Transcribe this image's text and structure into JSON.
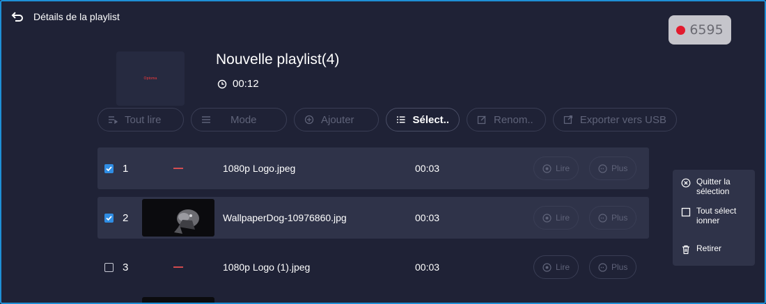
{
  "header": {
    "title": "Détails de la playlist",
    "back_icon": "back-arrow-icon"
  },
  "recording": {
    "count": "6595",
    "dot_color": "#e21b2e"
  },
  "playlist": {
    "logo_text": "Optoma",
    "title": "Nouvelle playlist(4)",
    "duration": "00:12"
  },
  "toolbar": [
    {
      "label": "Tout lire",
      "icon": "play-all-icon",
      "active": false
    },
    {
      "label": "Mode",
      "icon": "mode-icon",
      "active": false
    },
    {
      "label": "Ajouter",
      "icon": "add-icon",
      "active": false
    },
    {
      "label": "Sélect..",
      "icon": "select-list-icon",
      "active": true
    },
    {
      "label": "Renom..",
      "icon": "rename-icon",
      "active": false
    },
    {
      "label": "Exporter vers USB",
      "icon": "export-icon",
      "active": false
    }
  ],
  "rows": [
    {
      "index": "1",
      "checked": true,
      "name": "1080p Logo.jpeg",
      "duration": "00:03",
      "lire": "Lire",
      "plus": "Plus"
    },
    {
      "index": "2",
      "checked": true,
      "name": "WallpaperDog-10976860.jpg",
      "duration": "00:03",
      "lire": "Lire",
      "plus": "Plus"
    },
    {
      "index": "3",
      "checked": false,
      "name": "1080p Logo (1).jpeg",
      "duration": "00:03",
      "lire": "Lire",
      "plus": "Plus"
    }
  ],
  "side_menu": {
    "quit_line1": "Quitter la",
    "quit_line2": "sélection",
    "select_all_line1": "Tout sélect",
    "select_all_line2": "ionner",
    "remove": "Retirer"
  },
  "colors": {
    "accent": "#2f8de4",
    "background": "#1f2236",
    "selected_row": "#2f3349"
  }
}
